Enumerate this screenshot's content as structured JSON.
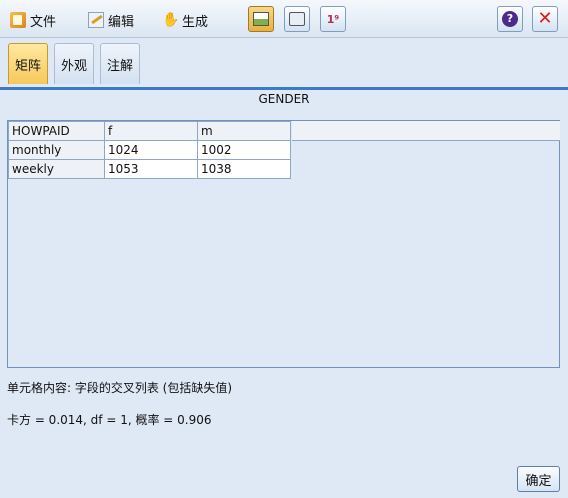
{
  "toolbar": {
    "file_label": "文件",
    "edit_label": "编辑",
    "generate_label": "生成",
    "help_symbol": "?",
    "close_symbol": "✕"
  },
  "tabs": [
    {
      "label": "矩阵",
      "active": true
    },
    {
      "label": "外观",
      "active": false
    },
    {
      "label": "注解",
      "active": false
    }
  ],
  "matrix": {
    "column_variable": "GENDER",
    "row_variable": "HOWPAID",
    "columns": [
      "f",
      "m"
    ],
    "rows": [
      {
        "label": "monthly",
        "values": [
          "1024",
          "1002"
        ]
      },
      {
        "label": "weekly",
        "values": [
          "1053",
          "1038"
        ]
      }
    ]
  },
  "footer": {
    "cell_contents": "单元格内容: 字段的交叉列表 (包括缺失值)",
    "chi_square": "卡方 = 0.014, df = 1, 概率 = 0.906",
    "ok_label": "确定"
  },
  "colors": {
    "accent": "#3e79c7",
    "active_tab": "#f6c85c",
    "background": "#dfe9f5"
  }
}
